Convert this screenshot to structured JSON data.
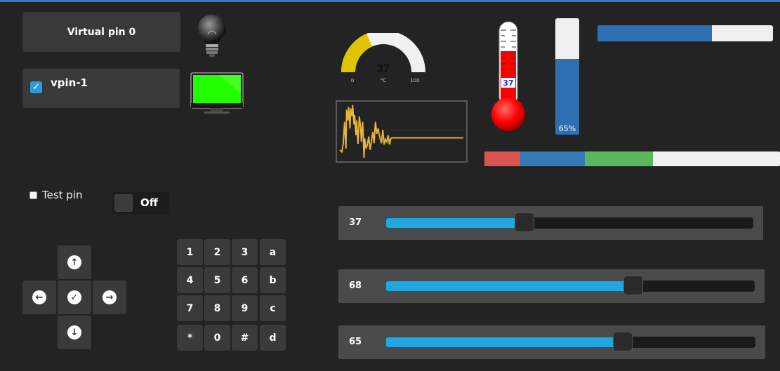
{
  "virtual_pin_button": {
    "label": "Virtual pin 0"
  },
  "vpin1": {
    "label": "vpin-1",
    "checked": true
  },
  "gauge": {
    "value": "37",
    "min_label": "0",
    "unit_label": "°C",
    "max_label": "100",
    "fraction": 0.37,
    "color": "#e0c400"
  },
  "chart": {
    "color": "#e8b53a"
  },
  "thermometer": {
    "value": "37",
    "fraction": 0.37,
    "color": "#ff0000"
  },
  "vertical_bar": {
    "label": "65%",
    "fraction": 0.65,
    "color": "#2f6fb0"
  },
  "horizontal_bar": {
    "fraction": 0.65,
    "color": "#2f6fb0"
  },
  "stacked_bar": {
    "segments": [
      {
        "fraction": 0.12,
        "color": "#d9534f"
      },
      {
        "fraction": 0.22,
        "color": "#337ab7"
      },
      {
        "fraction": 0.23,
        "color": "#5cb85c"
      }
    ]
  },
  "test_pin": {
    "label": "Test pin",
    "checked": false
  },
  "toggle": {
    "label": "Off",
    "state": false
  },
  "dpad": {
    "up_icon": "arrow-up-icon",
    "left_icon": "arrow-left-icon",
    "center_icon": "check-icon",
    "right_icon": "arrow-right-icon",
    "down_icon": "arrow-down-icon"
  },
  "keypad": {
    "keys": [
      "1",
      "2",
      "3",
      "a",
      "4",
      "5",
      "6",
      "b",
      "7",
      "8",
      "9",
      "c",
      "*",
      "0",
      "#",
      "d"
    ]
  },
  "sliders": [
    {
      "value": "37",
      "fraction": 0.37
    },
    {
      "value": "68",
      "fraction": 0.68
    },
    {
      "value": "65",
      "fraction": 0.65
    }
  ]
}
